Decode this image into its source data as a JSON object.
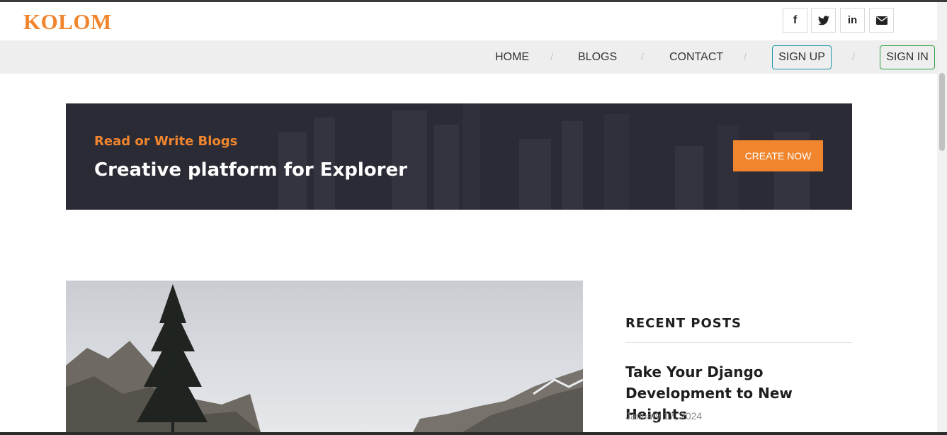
{
  "brand": {
    "logo": "KOLOM",
    "accent_color": "#f0852e"
  },
  "social": [
    {
      "name": "facebook",
      "glyph": "f",
      "icon": "facebook-icon"
    },
    {
      "name": "twitter",
      "glyph": "",
      "icon": "twitter-icon"
    },
    {
      "name": "linkedin",
      "glyph": "in",
      "icon": "linkedin-icon"
    },
    {
      "name": "email",
      "glyph": "",
      "icon": "envelope-icon"
    }
  ],
  "nav": {
    "home": "HOME",
    "blogs": "BLOGS",
    "contact": "CONTACT",
    "separator": "/",
    "signup": "SIGN UP",
    "signin": "SIGN IN"
  },
  "banner": {
    "subtitle": "Read or Write Blogs",
    "title": "Creative platform for Explorer",
    "cta": "CREATE NOW"
  },
  "sidebar": {
    "heading": "RECENT POSTS",
    "posts": [
      {
        "title": "Take Your Django Development to New Heights",
        "date": "January 17, 2024"
      }
    ]
  }
}
